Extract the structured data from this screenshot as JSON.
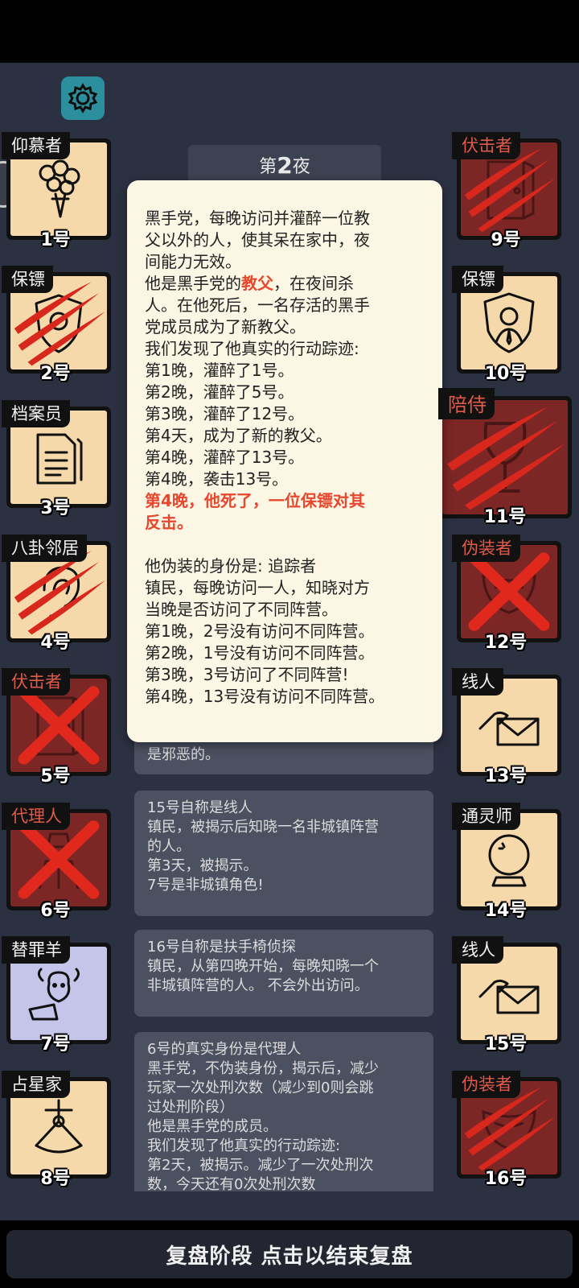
{
  "header": {
    "night_prefix": "第",
    "night_number": "2",
    "night_suffix": "夜"
  },
  "players_left": [
    {
      "role": "仰慕者",
      "num": "1号",
      "role_color": "white",
      "status": "alive",
      "icon": "bouquet-icon"
    },
    {
      "role": "保镖",
      "num": "2号",
      "role_color": "white",
      "status": "slashed",
      "icon": "shield-icon"
    },
    {
      "role": "档案员",
      "num": "3号",
      "role_color": "white",
      "status": "alive",
      "icon": "documents-icon"
    },
    {
      "role": "八卦邻居",
      "num": "4号",
      "role_color": "white",
      "status": "slashed",
      "icon": "ear-icon"
    },
    {
      "role": "伏击者",
      "num": "5号",
      "role_color": "red",
      "status": "crossed",
      "icon": "door-icon"
    },
    {
      "role": "代理人",
      "num": "6号",
      "role_color": "red",
      "status": "crossed",
      "icon": "agent-icon"
    },
    {
      "role": "替罪羊",
      "num": "7号",
      "role_color": "white",
      "status": "alive",
      "icon": "sheep-icon"
    },
    {
      "role": "占星家",
      "num": "8号",
      "role_color": "white",
      "status": "alive",
      "icon": "sextant-icon"
    }
  ],
  "players_right": [
    {
      "role": "伏击者",
      "num": "9号",
      "role_color": "red",
      "status": "slashed",
      "icon": "door-icon"
    },
    {
      "role": "保镖",
      "num": "10号",
      "role_color": "white",
      "status": "alive",
      "icon": "bodyguard-icon"
    },
    {
      "role": "陪侍",
      "num": "11号",
      "role_color": "red",
      "status": "slashed",
      "icon": "wine-glass-icon"
    },
    {
      "role": "伪装者",
      "num": "12号",
      "role_color": "red",
      "status": "crossed",
      "icon": "mask-icon"
    },
    {
      "role": "线人",
      "num": "13号",
      "role_color": "white",
      "status": "alive",
      "icon": "envelope-icon"
    },
    {
      "role": "通灵师",
      "num": "14号",
      "role_color": "white",
      "status": "alive",
      "icon": "crystal-ball-icon"
    },
    {
      "role": "线人",
      "num": "15号",
      "role_color": "white",
      "status": "alive",
      "icon": "envelope-icon"
    },
    {
      "role": "伪装者",
      "num": "16号",
      "role_color": "red",
      "status": "slashed",
      "icon": "mask-icon"
    }
  ],
  "popup": {
    "lines": [
      "黑手党，每晚访问并灌醉一位教",
      "父以外的人，使其呆在家中，夜",
      "间能力无效。"
    ],
    "identity_pre": "他是黑手党的",
    "identity_role": "教父",
    "identity_post": "，在夜间杀",
    "lines2": [
      "人。在他死后，一名存活的黑手",
      "党成员成为了新教父。",
      "我们发现了他真实的行动踪迹:",
      "第1晚，灌醉了1号。",
      "第2晚，灌醉了5号。",
      "第3晚，灌醉了12号。",
      "第4天，成为了新的教父。",
      "第4晚，灌醉了13号。",
      "第4晚，袭击13号。"
    ],
    "death_lines": [
      "第4晚，他死了，一位保镖对其",
      "反击。"
    ],
    "lines3": [
      "他伪装的身份是: 追踪者",
      "镇民，每晚访问一人，知晓对方",
      "当晚是否访问了不同阵营。",
      "第1晚，2号没有访问不同阵营。",
      "第2晚，1号没有访问不同阵营。",
      "第3晚，3号访问了不同阵营!",
      "第4晚，13号没有访问不同阵营。"
    ]
  },
  "log": {
    "partial_top": "是邪恶的。",
    "entry1": [
      "15号自称是线人",
      "镇民，被揭示后知晓一名非城镇阵营",
      "的人。",
      "第3天，被揭示。",
      "7号是非城镇角色!"
    ],
    "entry2": [
      "16号自称是扶手椅侦探",
      "镇民，从第四晚开始，每晚知晓一个",
      "非城镇阵营的人。 不会外出访问。"
    ],
    "entry3": [
      "6号的真实身份是代理人",
      "黑手党，不伪装身份，揭示后，减少",
      "玩家一次处刑次数（减少到0则会跳",
      "过处刑阶段）",
      "他是黑手党的成员。",
      "我们发现了他真实的行动踪迹:",
      "第2天，被揭示。减少了一次处刑次",
      "数，今天还有0次处刑次数"
    ]
  },
  "footer": {
    "label": "复盘阶段 点击以结束复盘"
  },
  "colors": {
    "background": "#2c3142",
    "card_light": "#f6d9aa",
    "card_dark": "#7c2626",
    "slash_red": "#d8271c",
    "popup_bg": "#fbf7e4",
    "accent_red": "#e8462d",
    "gear_teal": "#2b8f9d"
  }
}
